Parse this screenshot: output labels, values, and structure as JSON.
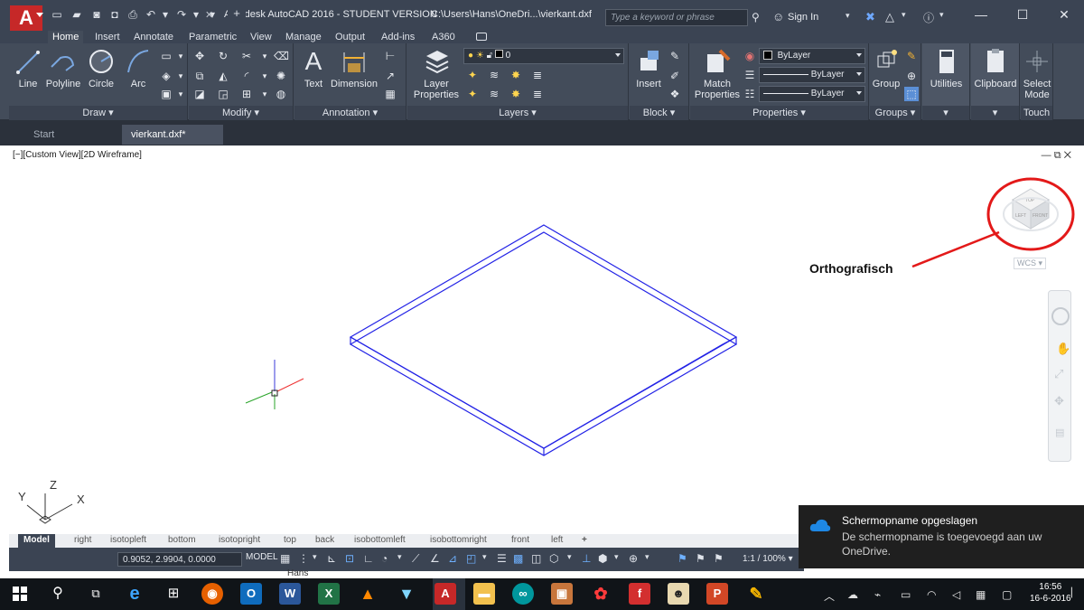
{
  "window": {
    "title": "Autodesk AutoCAD 2016 - STUDENT VERSION",
    "path": "C:\\Users\\Hans\\OneDri...\\vierkant.dxf",
    "logo_letter": "A",
    "search_placeholder": "Type a keyword or phrase",
    "sign_in": "Sign In"
  },
  "ribbon_tabs": [
    "Home",
    "Insert",
    "Annotate",
    "Parametric",
    "View",
    "Manage",
    "Output",
    "Add-ins",
    "A360"
  ],
  "ribbon": {
    "draw": {
      "line": "Line",
      "polyline": "Polyline",
      "circle": "Circle",
      "arc": "Arc",
      "label": "Draw"
    },
    "modify": {
      "label": "Modify"
    },
    "annotation": {
      "text": "Text",
      "dimension": "Dimension",
      "label": "Annotation"
    },
    "layers": {
      "layer_properties": "Layer Properties",
      "current_layer": "0",
      "label": "Layers"
    },
    "block": {
      "insert": "Insert",
      "label": "Block"
    },
    "properties": {
      "match": "Match Properties",
      "color": "ByLayer",
      "linetype": "ByLayer",
      "lineweight": "ByLayer",
      "label": "Properties"
    },
    "groups": {
      "group": "Group",
      "label": "Groups"
    },
    "utilities": {
      "label": "Utilities"
    },
    "clipboard": {
      "label": "Clipboard"
    },
    "touch": {
      "select_mode": "Select Mode",
      "label": "Touch"
    }
  },
  "file_tabs": [
    {
      "label": "Start"
    },
    {
      "label": "vierkant.dxf*"
    }
  ],
  "viewport": {
    "label": "[−][Custom View][2D Wireframe]",
    "annotation": "Orthografisch",
    "wcs": "WCS",
    "viewcube_faces": {
      "top": "TOP",
      "left": "LEFT",
      "front": "FRONT"
    },
    "ucs_axes": {
      "x": "X",
      "y": "Y",
      "z": "Z"
    }
  },
  "layout_tabs": [
    "Model",
    "right",
    "isotopleft",
    "bottom",
    "isotopright",
    "top",
    "back",
    "isobottomleft",
    "isobottomright",
    "front",
    "left"
  ],
  "status": {
    "coordinates": "0.9052, 2.9904, 0.0000",
    "model": "MODEL",
    "scale": "1:1 / 100%",
    "behind_text": "Hans"
  },
  "notification": {
    "title": "Schermopname opgeslagen",
    "body": "De schermopname is toegevoegd aan uw OneDrive."
  },
  "taskbar": {
    "time": "16:56",
    "date": "16-6-2016",
    "apps": [
      "start",
      "search",
      "task-view",
      "edge",
      "store",
      "firefox",
      "outlook",
      "word",
      "excel",
      "vlc",
      "app",
      "autocad",
      "file-explorer",
      "arduino",
      "app",
      "app",
      "app",
      "app",
      "app",
      "powerpoint",
      "app"
    ]
  },
  "colors": {
    "titlebar": "#3b4453",
    "ribbon": "#434c5a",
    "drawing_line": "#2323e6",
    "annotation_red": "#e31919",
    "notification_bg": "#1f1f1f"
  }
}
